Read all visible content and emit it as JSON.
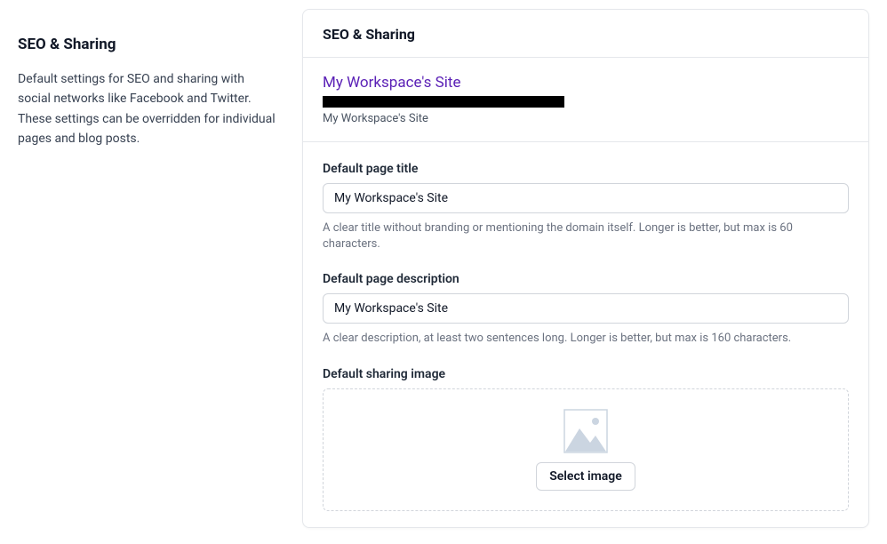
{
  "sidebar": {
    "title": "SEO & Sharing",
    "description": "Default settings for SEO and sharing with social networks like Facebook and Twitter. These settings can be overridden for individual pages and blog posts."
  },
  "card": {
    "title": "SEO & Sharing",
    "preview": {
      "title": "My Workspace's Site",
      "description": "My Workspace's Site"
    },
    "fields": {
      "page_title": {
        "label": "Default page title",
        "value": "My Workspace's Site",
        "help": "A clear title without branding or mentioning the domain itself. Longer is better, but max is 60 characters."
      },
      "page_description": {
        "label": "Default page description",
        "value": "My Workspace's Site",
        "help": "A clear description, at least two sentences long. Longer is better, but max is 160 characters."
      },
      "sharing_image": {
        "label": "Default sharing image",
        "button_label": "Select image"
      }
    }
  }
}
